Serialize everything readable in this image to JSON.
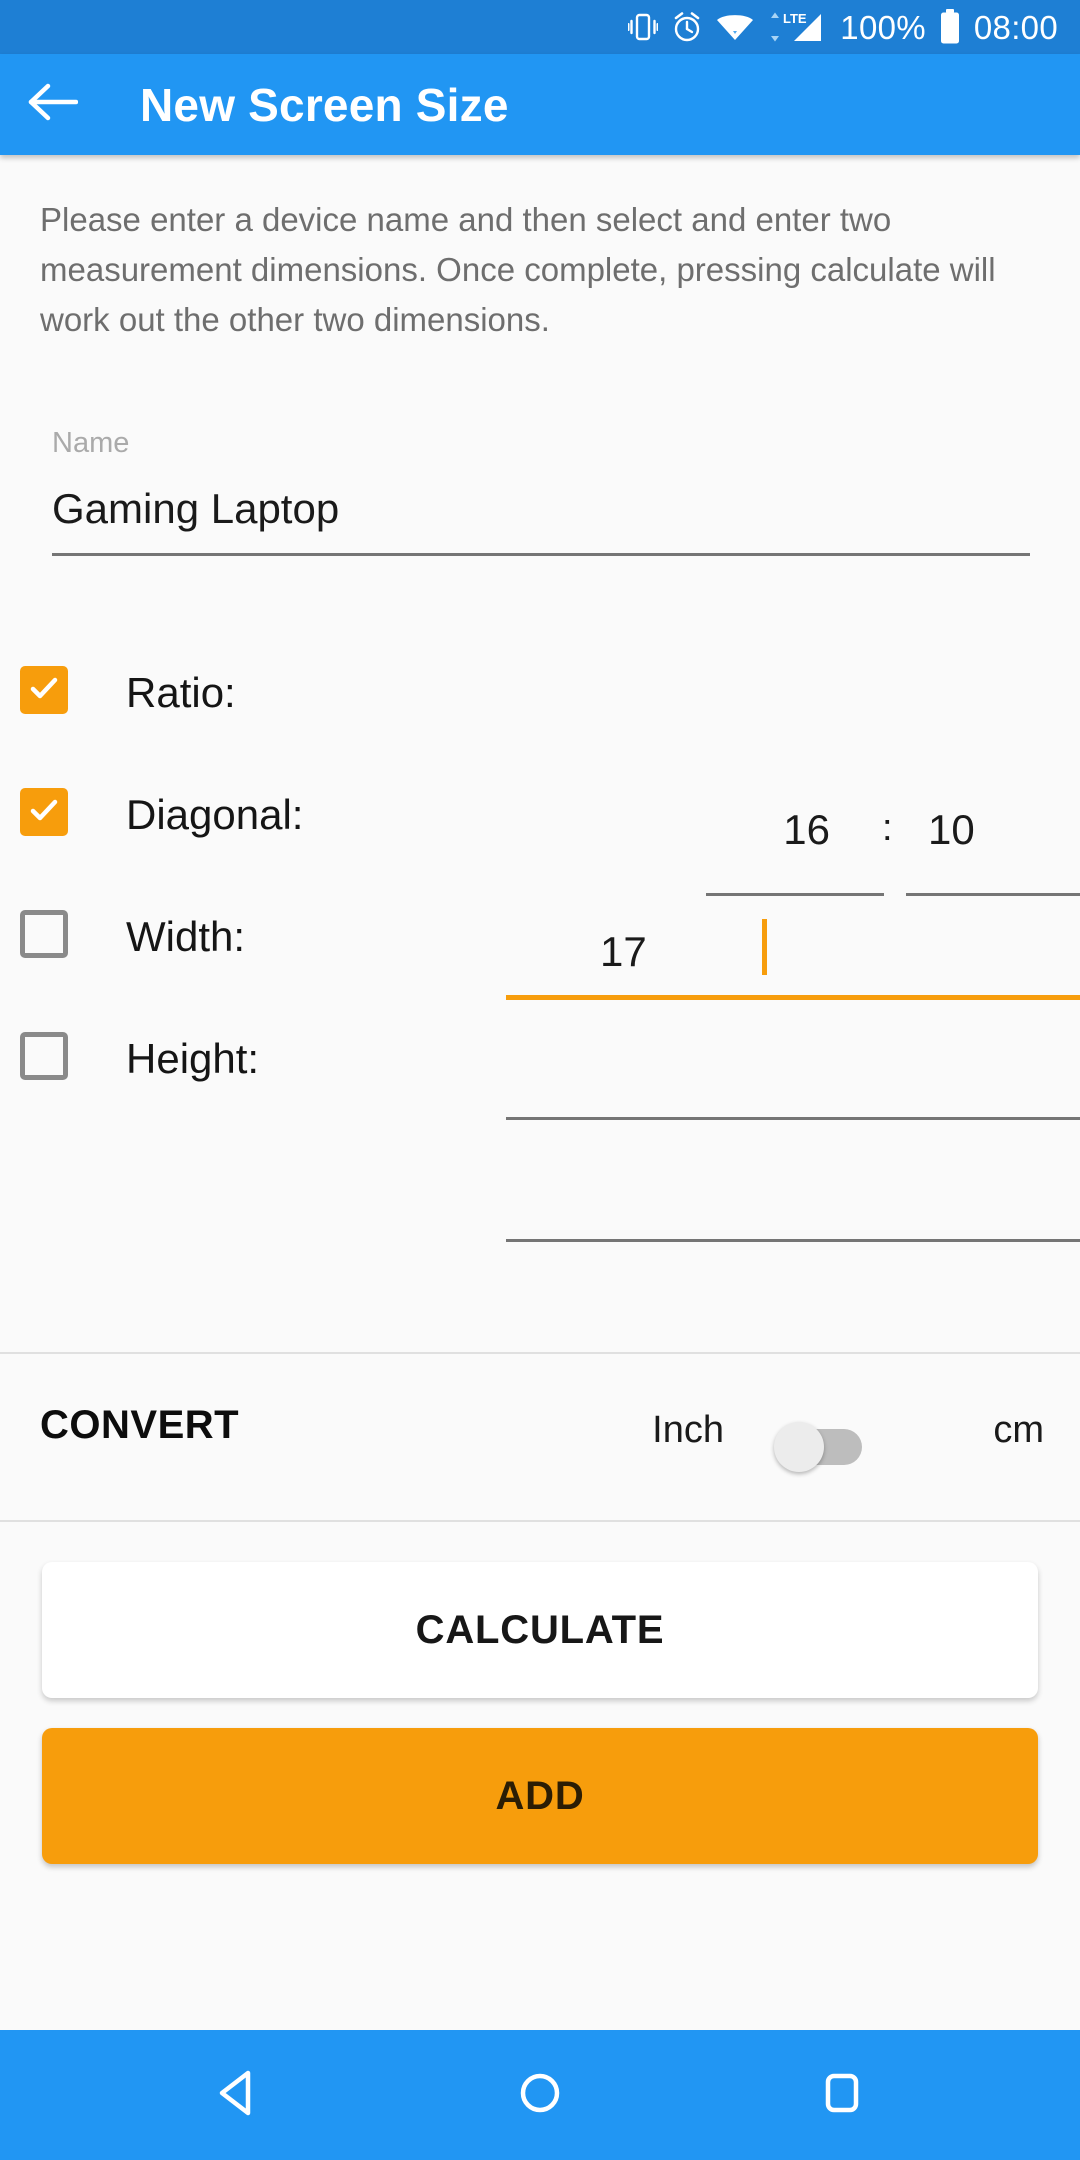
{
  "status_bar": {
    "icons": [
      "vibrate-icon",
      "alarm-icon",
      "wifi-icon",
      "lte-signal-icon"
    ],
    "lte_label": "LTE",
    "battery_percent": "100%",
    "clock": "08:00"
  },
  "app_bar": {
    "back_icon": "back-arrow-icon",
    "title": "New Screen Size"
  },
  "content": {
    "description": "Please enter a device name and then select and enter two measurement dimensions. Once complete, pressing calculate will work out the other two dimensions.",
    "name_field": {
      "label": "Name",
      "value": "Gaming Laptop",
      "placeholder": ""
    },
    "rows": [
      {
        "key": "ratio",
        "label": "Ratio:",
        "checked": true,
        "value_a": "16",
        "separator": ":",
        "value_b": "10",
        "focused": false
      },
      {
        "key": "diagonal",
        "label": "Diagonal:",
        "checked": true,
        "value": "17",
        "focused": true
      },
      {
        "key": "width",
        "label": "Width:",
        "checked": false,
        "value": "",
        "focused": false
      },
      {
        "key": "height",
        "label": "Height:",
        "checked": false,
        "value": "",
        "focused": false
      }
    ],
    "convert": {
      "label": "CONVERT",
      "unit_left": "Inch",
      "unit_right": "cm",
      "toggle_on": false
    },
    "buttons": {
      "calculate": "CALCULATE",
      "add": "ADD"
    }
  },
  "nav_bar": {
    "back": "nav-back-icon",
    "home": "nav-home-icon",
    "recents": "nav-recents-icon"
  },
  "colors": {
    "status_bar": "#1E7FD4",
    "app_bar": "#2196F3",
    "accent_orange": "#F79D0C",
    "background": "#FAFAFA",
    "text_primary": "#1A1A1A",
    "text_secondary": "#6E6E6E"
  }
}
